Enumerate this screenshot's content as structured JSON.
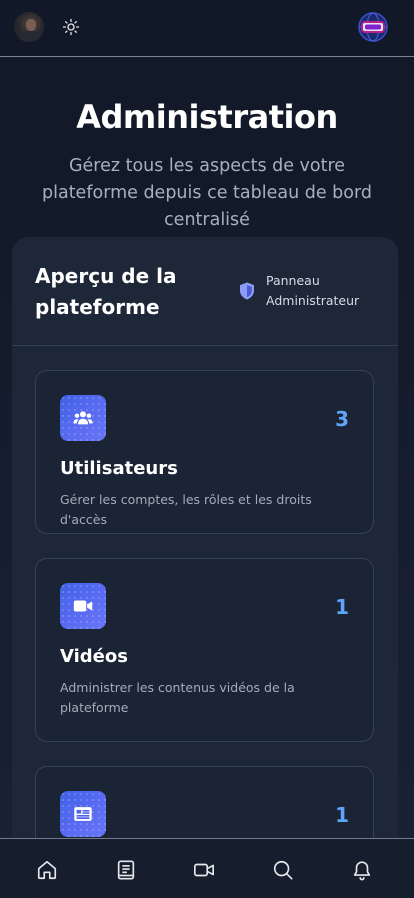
{
  "header": {
    "avatar_icon": "user-avatar",
    "theme_icon": "sun-icon",
    "language_icon": "globe-icon"
  },
  "hero": {
    "title": "Administration",
    "subtitle": "Gérez tous les aspects de votre plateforme depuis ce tableau de bord centralisé"
  },
  "overview": {
    "title": "Aperçu de la plateforme",
    "badge": "Panneau Administrateur",
    "badge_icon": "shield-icon",
    "modules": [
      {
        "name": "Utilisateurs",
        "count": "3",
        "description": "Gérer les comptes, les rôles et les droits d'accès",
        "icon": "users-icon"
      },
      {
        "name": "Vidéos",
        "count": "1",
        "description": "Administrer les contenus vidéos de la plateforme",
        "icon": "video-icon"
      },
      {
        "name": "",
        "count": "1",
        "description": "",
        "icon": "article-icon"
      }
    ]
  },
  "bottom_nav": {
    "items": [
      {
        "icon": "home-icon"
      },
      {
        "icon": "book-icon"
      },
      {
        "icon": "video-icon"
      },
      {
        "icon": "search-icon"
      },
      {
        "icon": "bell-icon"
      }
    ]
  },
  "colors": {
    "background": "#111827",
    "card": "#1e2738",
    "accent": "#60a5fa",
    "icon_gradient_start": "#3f62e6",
    "icon_gradient_end": "#6875f5"
  }
}
